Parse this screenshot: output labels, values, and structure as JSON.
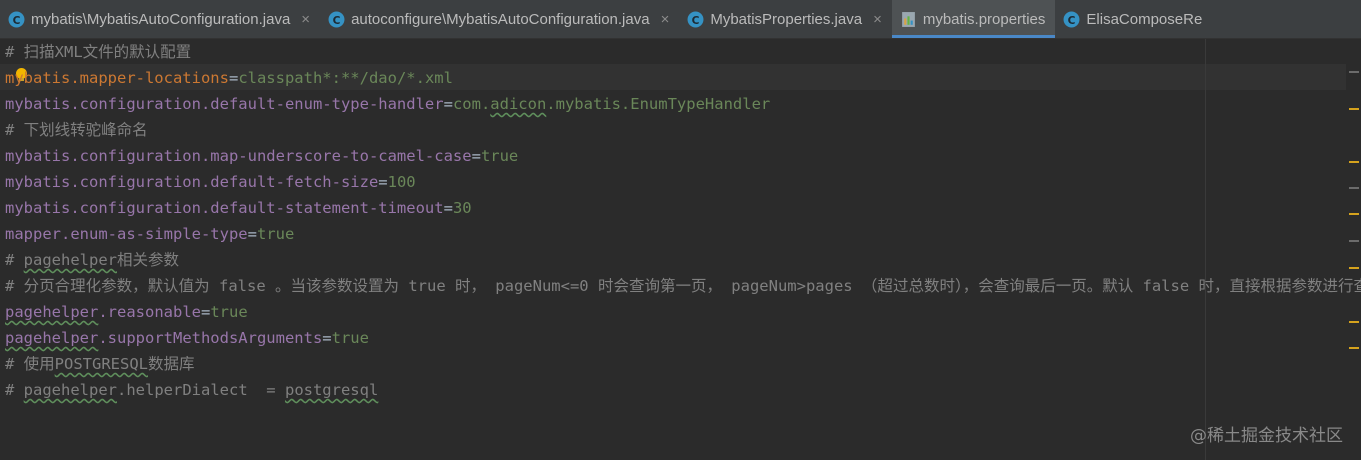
{
  "tabs": [
    {
      "label": "mybatis\\MybatisAutoConfiguration.java",
      "icon": "java-class-icon",
      "active": false
    },
    {
      "label": "autoconfigure\\MybatisAutoConfiguration.java",
      "icon": "java-class-icon",
      "active": false
    },
    {
      "label": "MybatisProperties.java",
      "icon": "java-class-icon",
      "active": false
    },
    {
      "label": "mybatis.properties",
      "icon": "properties-file-icon",
      "active": true
    },
    {
      "label": "ElisaComposeRe",
      "icon": "java-class-icon",
      "active": false
    }
  ],
  "close_glyph": "×",
  "code": {
    "l1": "# 扫描XML文件的默认配置",
    "l2_key": "mybatis.mapper-locations",
    "l2_eq": "=",
    "l2_val": "classpath*:**/dao/*.xml",
    "l3_key": "mybatis.configuration.default-enum-type-handler",
    "l3_eq": "=",
    "l3_val1": "com.",
    "l3_val2": "adicon",
    "l3_val3": ".mybatis.EnumTypeHandler",
    "l4": "# 下划线转驼峰命名",
    "l5_key": "mybatis.configuration.map-underscore-to-camel-case",
    "l5_eq": "=",
    "l5_val": "true",
    "l6_key": "mybatis.configuration.default-fetch-size",
    "l6_eq": "=",
    "l6_val": "100",
    "l7_key": "mybatis.configuration.default-statement-timeout",
    "l7_eq": "=",
    "l7_val": "30",
    "l8_key": "mapper.enum-as-simple-type",
    "l8_eq": "=",
    "l8_val": "true",
    "l9_a": "# ",
    "l9_b": "pagehelper",
    "l9_c": "相关参数",
    "l10": "# 分页合理化参数，默认值为 false 。当该参数设置为 true 时， pageNum<=0 时会查询第一页， pageNum>pages （超过总数时），会查询最后一页。默认 false 时，直接根据参数进行查询",
    "l11_a": "pagehelper",
    "l11_b": ".reasonable",
    "l11_eq": "=",
    "l11_val": "true",
    "l12_a": "pagehelper",
    "l12_b": ".supportMethodsArguments",
    "l12_eq": "=",
    "l12_val": "true",
    "l13_a": "# 使用",
    "l13_b": "POSTGRESQL",
    "l13_c": "数据库",
    "l14_a": "# ",
    "l14_b": "pagehelper",
    "l14_c": ".helperDialect  = ",
    "l14_d": "postgresql"
  },
  "watermark": "@稀土掘金技术社区",
  "colors": {
    "background": "#2b2b2b",
    "comment": "#808080",
    "key": "#9876aa",
    "value": "#6a8759",
    "active_tab_underline": "#4a88c7",
    "marker": "#d5a21d"
  }
}
